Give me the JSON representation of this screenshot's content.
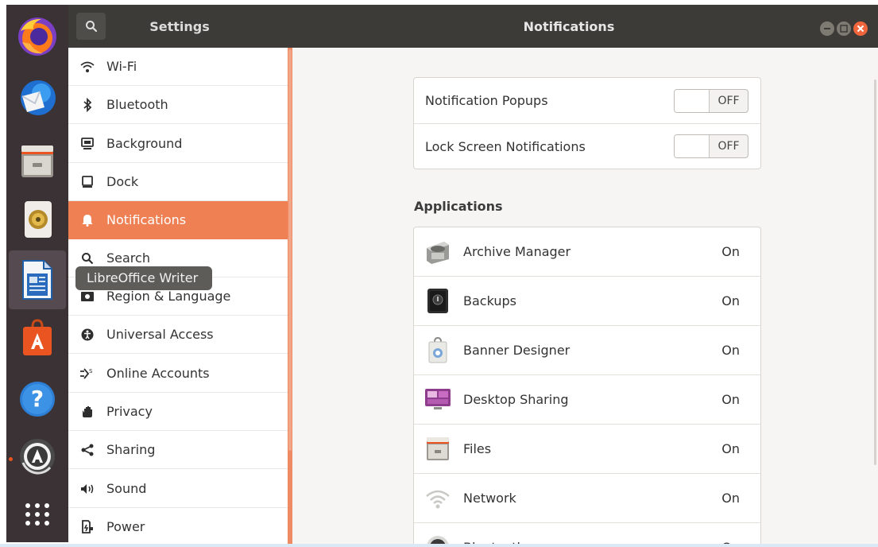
{
  "header": {
    "app_title": "Settings",
    "page_title": "Notifications"
  },
  "dock": {
    "apps": [
      {
        "name": "firefox-icon"
      },
      {
        "name": "thunderbird-icon"
      },
      {
        "name": "files-icon"
      },
      {
        "name": "rhythmbox-icon"
      },
      {
        "name": "libreoffice-writer-icon",
        "active": true
      },
      {
        "name": "software-icon"
      },
      {
        "name": "help-icon"
      },
      {
        "name": "software-updater-icon",
        "running": true
      },
      {
        "name": "show-apps-icon"
      }
    ],
    "tooltip": "LibreOffice Writer"
  },
  "sidebar": {
    "items": [
      {
        "label": "Wi-Fi",
        "icon": "wifi-icon"
      },
      {
        "label": "Bluetooth",
        "icon": "bluetooth-icon"
      },
      {
        "label": "Background",
        "icon": "background-icon"
      },
      {
        "label": "Dock",
        "icon": "dock-icon"
      },
      {
        "label": "Notifications",
        "icon": "bell-icon",
        "selected": true
      },
      {
        "label": "Search",
        "icon": "search-icon"
      },
      {
        "label": "Region & Language",
        "icon": "region-icon"
      },
      {
        "label": "Universal Access",
        "icon": "accessibility-icon"
      },
      {
        "label": "Online Accounts",
        "icon": "online-accounts-icon"
      },
      {
        "label": "Privacy",
        "icon": "privacy-hand-icon"
      },
      {
        "label": "Sharing",
        "icon": "sharing-icon"
      },
      {
        "label": "Sound",
        "icon": "speaker-icon"
      },
      {
        "label": "Power",
        "icon": "power-icon"
      }
    ]
  },
  "main": {
    "toggles": [
      {
        "label": "Notification Popups",
        "state": "OFF"
      },
      {
        "label": "Lock Screen Notifications",
        "state": "OFF"
      }
    ],
    "apps_heading": "Applications",
    "apps": [
      {
        "name": "Archive Manager",
        "state": "On",
        "icon": "archive-manager-icon"
      },
      {
        "name": "Backups",
        "state": "On",
        "icon": "backups-icon"
      },
      {
        "name": "Banner Designer",
        "state": "On",
        "icon": "banner-designer-icon"
      },
      {
        "name": "Desktop Sharing",
        "state": "On",
        "icon": "desktop-sharing-icon"
      },
      {
        "name": "Files",
        "state": "On",
        "icon": "files-icon"
      },
      {
        "name": "Network",
        "state": "On",
        "icon": "network-icon"
      },
      {
        "name": "Bluetooth",
        "state": "On",
        "icon": "bluetooth-app-icon"
      }
    ]
  },
  "colors": {
    "accent": "#ef8054",
    "dock_bg": "#3b3236",
    "header_bg": "#3c3b37",
    "close_button": "#f0653b"
  }
}
